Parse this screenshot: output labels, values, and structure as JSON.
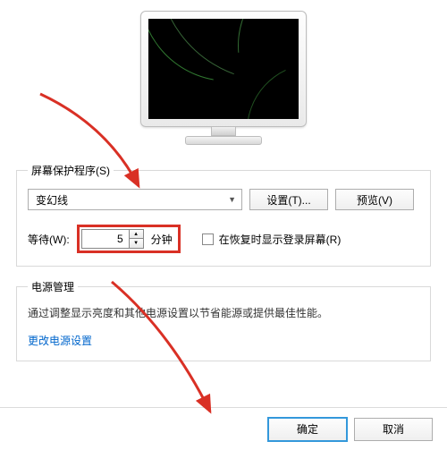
{
  "fieldset_screensaver": {
    "legend": "屏幕保护程序(S)",
    "selected": "变幻线",
    "btn_settings": "设置(T)...",
    "btn_preview": "预览(V)"
  },
  "wait": {
    "label": "等待(W):",
    "value": "5",
    "unit": "分钟",
    "resume_label": "在恢复时显示登录屏幕(R)"
  },
  "power": {
    "legend": "电源管理",
    "desc": "通过调整显示亮度和其他电源设置以节省能源或提供最佳性能。",
    "link": "更改电源设置"
  },
  "buttons": {
    "ok": "确定",
    "cancel": "取消"
  },
  "annotation_color": "#d93025"
}
